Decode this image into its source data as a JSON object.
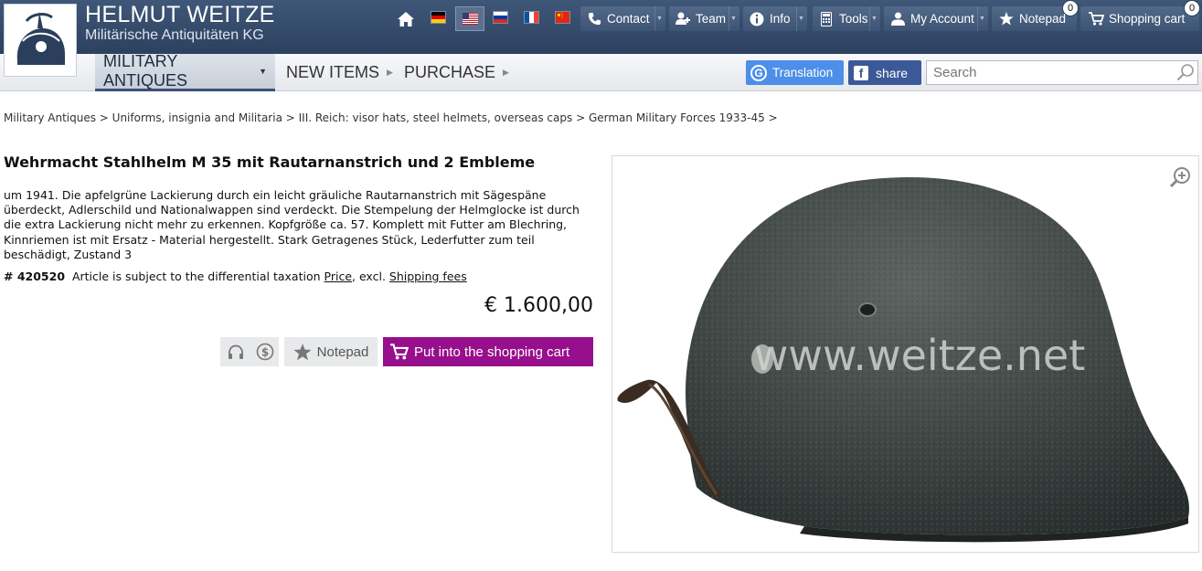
{
  "header": {
    "brand_name": "HELMUT WEITZE",
    "brand_sub": "Militärische Antiquitäten KG",
    "nav": {
      "contact": "Contact",
      "team": "Team",
      "info": "Info",
      "tools": "Tools",
      "account": "My Account",
      "notepad": "Notepad",
      "notepad_count": "0",
      "cart": "Shopping cart",
      "cart_count": "0"
    },
    "languages": [
      "de",
      "en",
      "ru",
      "fr",
      "cn"
    ]
  },
  "menu": {
    "items": [
      {
        "label": "MILITARY ANTIQUES"
      },
      {
        "label": "NEW ITEMS"
      },
      {
        "label": "PURCHASE"
      }
    ],
    "translation": "Translation",
    "share": "share",
    "search_placeholder": "Search"
  },
  "breadcrumb": [
    "Military Antiques",
    "Uniforms, insignia and Militaria",
    "III. Reich: visor hats, steel helmets, overseas caps",
    "German Military Forces 1933-45"
  ],
  "product": {
    "title": "Wehrmacht Stahlhelm M 35 mit Rautarnanstrich und 2 Embleme",
    "description_lines": [
      "um 1941. Die apfelgrüne Lackierung durch ein leicht gräuliche Rautarnanstrich mit Sägespäne",
      "überdeckt, Adlerschild und Nationalwappen sind verdeckt. Die Stempelung der Helmglocke ist durch",
      "die extra Lackierung nicht mehr zu erkennen. Kopfgröße ca. 57. Komplett mit Futter am Blechring,",
      "Kinnriemen ist mit Ersatz - Material hergestellt. Stark Getragenes Stück, Lederfutter zum teil",
      "beschädigt, Zustand 3"
    ],
    "article_no": "# 420520",
    "tax_note": "Article is subject to the differential taxation",
    "price_link": "Price",
    "excl": ", excl.",
    "shipping_link": "Shipping fees",
    "price": "€ 1.600,00",
    "notepad_button": "Notepad",
    "cart_button": "Put into the shopping cart",
    "watermark": "www.weitze.net"
  },
  "colors": {
    "topbar": "#34496a",
    "cart_button": "#970f8c",
    "translation": "#4d8fe8",
    "facebook": "#3b5998"
  }
}
